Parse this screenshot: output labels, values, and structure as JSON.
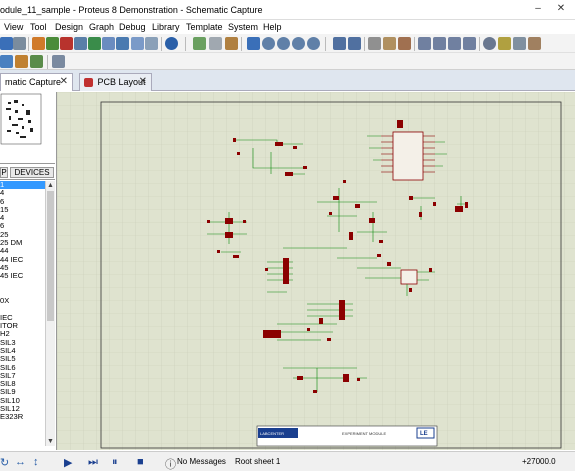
{
  "window": {
    "title": "odule_11_sample - Proteus 8 Demonstration - Schematic Capture",
    "minimize": "–",
    "close": "✕"
  },
  "menu": [
    "View",
    "Tool",
    "Design",
    "Graph",
    "Debug",
    "Library",
    "Template",
    "System",
    "Help"
  ],
  "tabs": [
    {
      "label": "matic Capture",
      "close": "✕",
      "active": true
    },
    {
      "label": "PCB Layout",
      "close": "✕",
      "active": false
    }
  ],
  "panel": {
    "p_label": "P",
    "devices_label": "DEVICES",
    "device_list": [
      "1",
      "4",
      "6",
      "15",
      "4",
      "6",
      "25",
      "25 DM",
      "44",
      "44 IEC",
      "45",
      "45 IEC",
      "",
      "",
      "0X",
      "",
      "IEC",
      "ITOR",
      "H2",
      "SIL3",
      "SIL4",
      "SIL5",
      "SIL6",
      "SIL7",
      "SIL8",
      "SIL9",
      "SIL10",
      "SIL12",
      "E323R"
    ],
    "selected_index": 0
  },
  "schematic": {
    "title_block_left": "LABCENTER",
    "title_block_mid": "EXPERIMENT MODULE",
    "title_block_right": "LE"
  },
  "status": {
    "messages": "No Messages",
    "sheet": "Root sheet 1",
    "coord": "+27000.0"
  },
  "colors": {
    "canvas_bg": "#dfe3cf",
    "grid": "#c9cdb7",
    "wire": "#0a8a0a",
    "component": "#8b0000",
    "selected_list": "#3399ff"
  }
}
